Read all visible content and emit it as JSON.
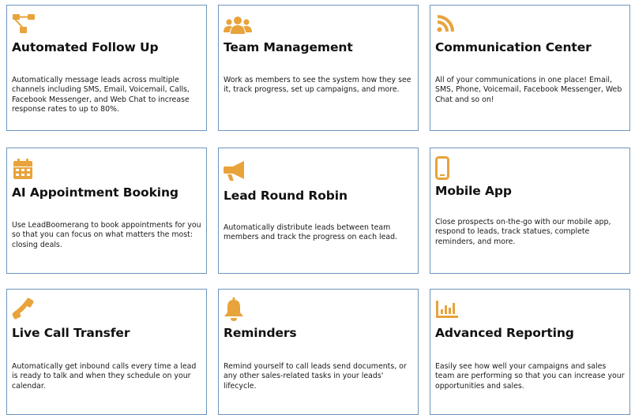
{
  "accent_color": "#e8a33b",
  "border_color": "#6d95bd",
  "features": [
    {
      "icon": "flowchart-icon",
      "title": "Automated Follow Up",
      "description": "Automatically message leads across multiple channels including SMS, Email, Voicemail, Calls, Facebook Messenger, and Web Chat to increase response rates to up to 80%."
    },
    {
      "icon": "users-icon",
      "title": "Team Management",
      "description": "Work as members to see the system how they see it, track progress, set up campaigns, and more."
    },
    {
      "icon": "rss-icon",
      "title": "Communication Center",
      "description": "All of your communications in one place! Email, SMS, Phone, Voicemail, Facebook Messenger, Web Chat and so on!"
    },
    {
      "icon": "calendar-icon",
      "title": "AI Appointment Booking",
      "description": "Use LeadBoomerang to book appointments for you so that you can focus on what matters the most: closing deals."
    },
    {
      "icon": "megaphone-icon",
      "title": "Lead Round Robin",
      "description": "Automatically distribute leads between team members and track the progress on each lead."
    },
    {
      "icon": "mobile-phone-icon",
      "title": "Mobile App",
      "description": "Close prospects on-the-go with our mobile app, respond to leads, track statues, complete reminders, and more."
    },
    {
      "icon": "phone-icon",
      "title": "Live Call Transfer",
      "description": "Automatically get inbound calls every time a lead is ready to talk and when they schedule on your calendar."
    },
    {
      "icon": "bell-icon",
      "title": "Reminders",
      "description": "Remind yourself to call leads send documents, or any other sales-related tasks in your leads' lifecycle."
    },
    {
      "icon": "bar-chart-icon",
      "title": "Advanced Reporting",
      "description": "Easily see how well your campaigns and sales team are performing so that you can increase your opportunities and sales."
    }
  ]
}
